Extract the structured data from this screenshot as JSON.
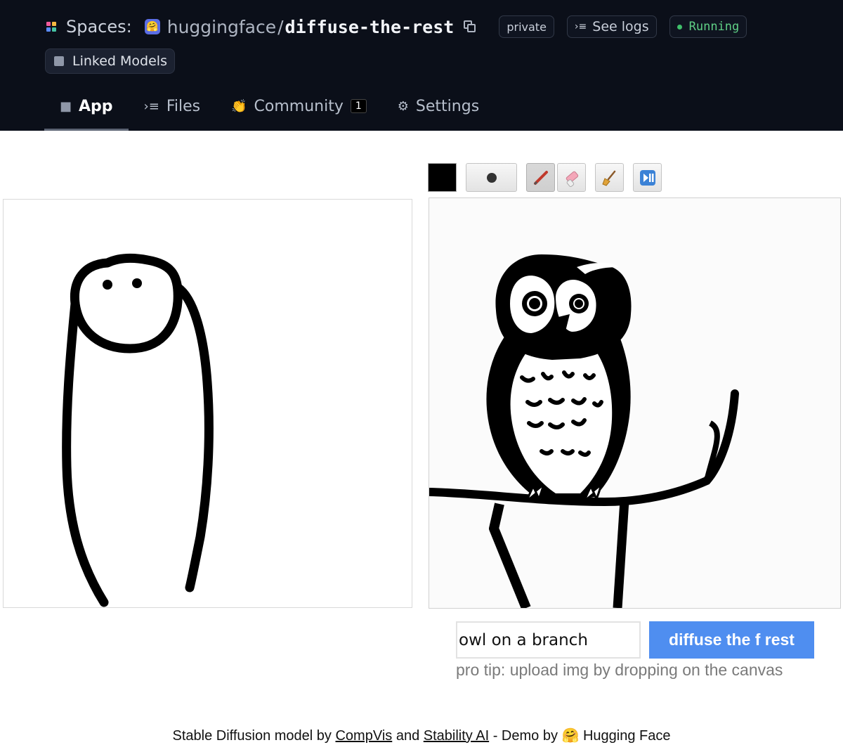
{
  "header": {
    "spaces_label": "Spaces:",
    "org_name": "huggingface",
    "separator": "/",
    "repo_name": "diffuse-the-rest",
    "visibility_badge": "private",
    "see_logs_label": "See logs",
    "status_label": "Running",
    "linked_models_label": "Linked Models",
    "colors": {
      "background": "#0b0f19",
      "running": "#5fcf85"
    }
  },
  "tabs": [
    {
      "label": "App",
      "icon": "cube-icon",
      "active": true
    },
    {
      "label": "Files",
      "icon": "files-icon"
    },
    {
      "label": "Community",
      "icon": "community-icon",
      "badge": "1"
    },
    {
      "label": "Settings",
      "icon": "gear-icon"
    }
  ],
  "toolbar": {
    "color": "#000000",
    "tools": [
      "brush-size-icon",
      "pencil-icon",
      "eraser-icon",
      "broom-icon",
      "play-pause-icon"
    ]
  },
  "prompt": {
    "value": "owl on a branch",
    "button_label": "diffuse the f rest",
    "pro_tip": "pro tip: upload img by dropping on the canvas",
    "button_color": "#4f8ef0"
  },
  "footer": {
    "part1": "Stable Diffusion model by ",
    "link1": "CompVis",
    "part2": " and ",
    "link2": "Stability AI",
    "part3": " - Demo by ",
    "emoji": "🤗",
    "part4": " Hugging Face"
  }
}
